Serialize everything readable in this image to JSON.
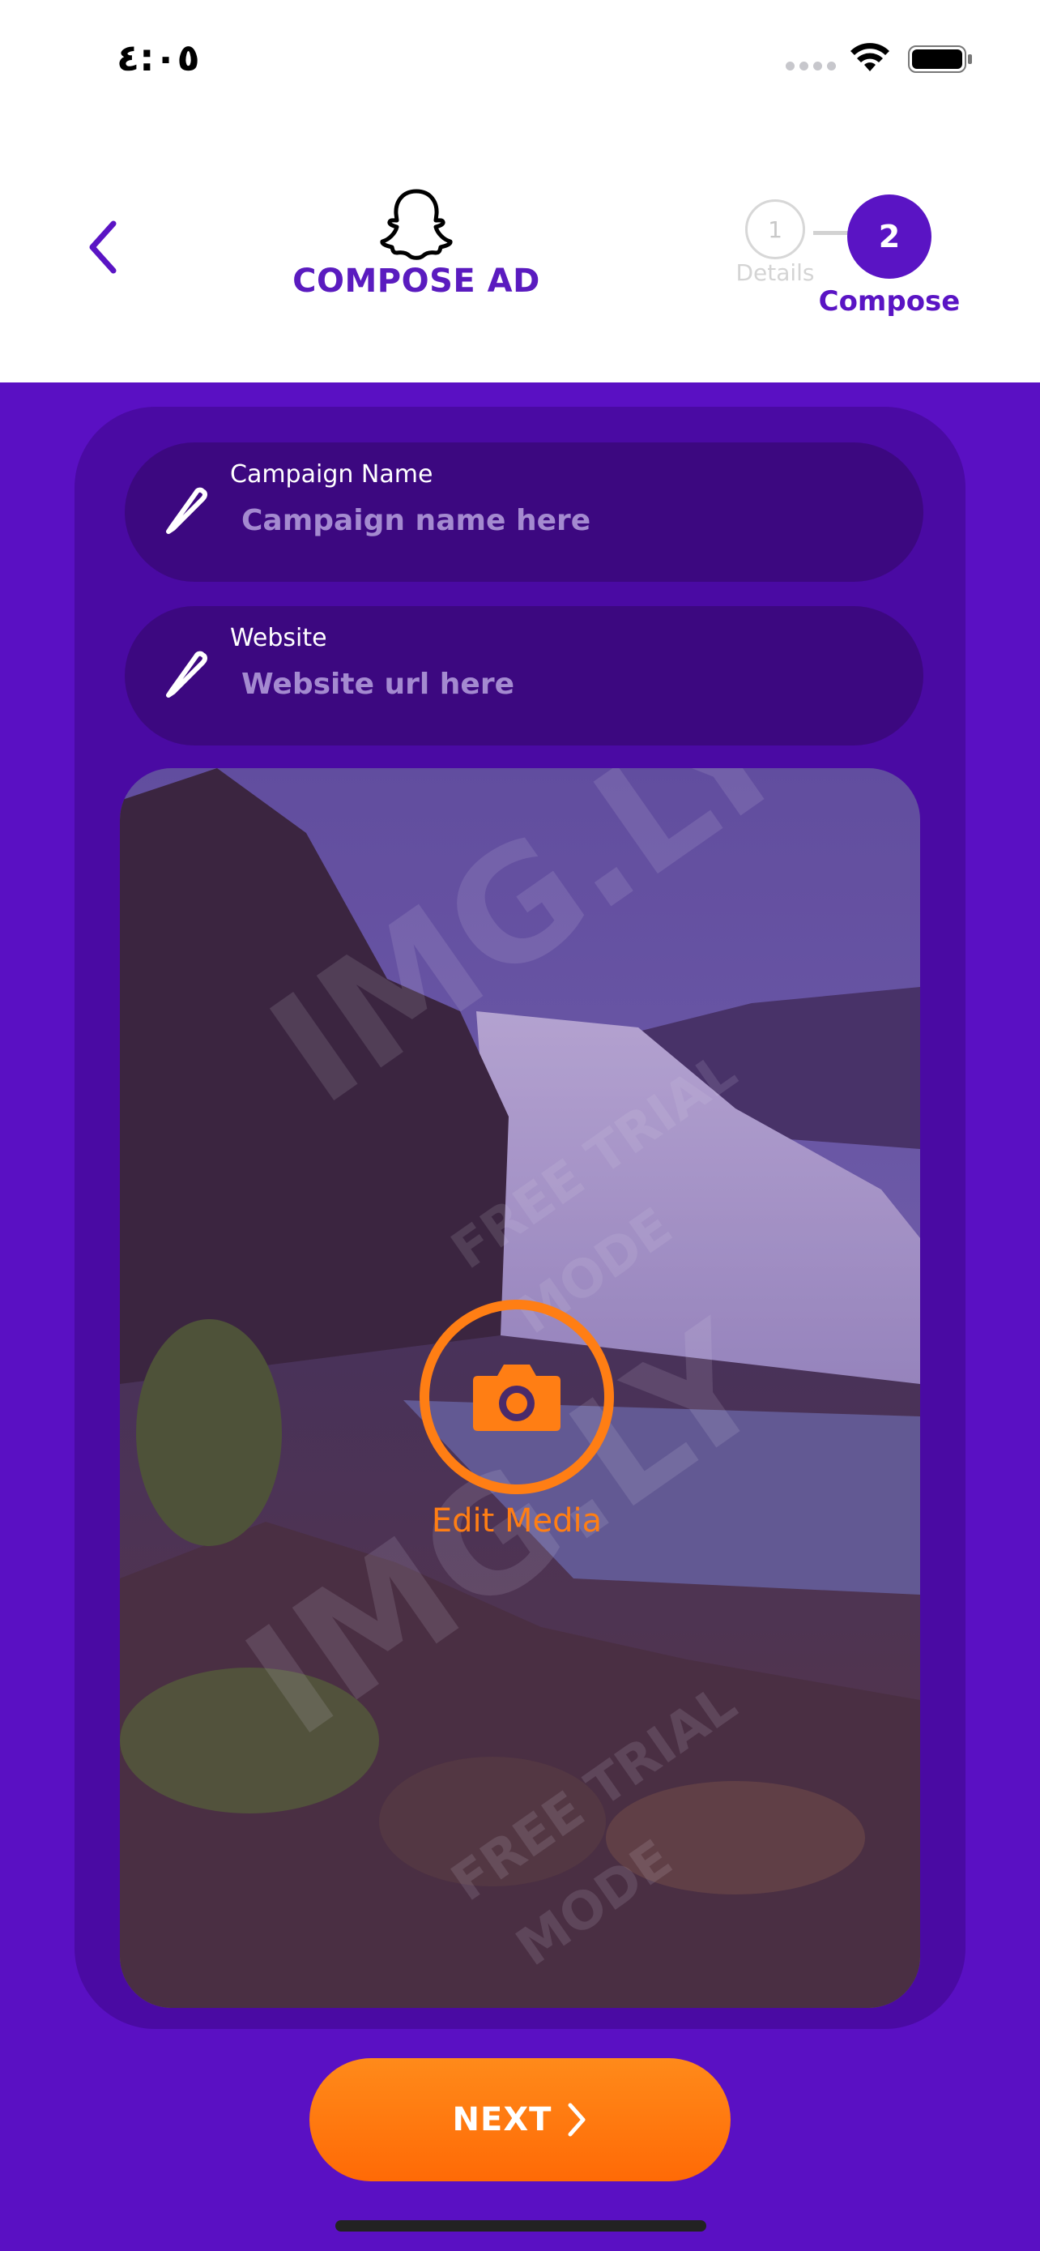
{
  "status_bar": {
    "time": "٤:٠٥"
  },
  "header": {
    "title": "COMPOSE AD",
    "steps": [
      {
        "number": "1",
        "label": "Details",
        "active": false
      },
      {
        "number": "2",
        "label": "Compose",
        "active": true
      }
    ]
  },
  "form": {
    "campaign_name": {
      "label": "Campaign Name",
      "placeholder": "Campaign name here",
      "value": ""
    },
    "website": {
      "label": "Website",
      "placeholder": "Website url here",
      "value": ""
    }
  },
  "media": {
    "edit_label": "Edit Media",
    "watermark_lines": [
      "IMG.LY",
      "FREE TRIAL",
      "MODE"
    ]
  },
  "footer": {
    "next_label": "NEXT"
  },
  "colors": {
    "brand_purple": "#5a14c4",
    "accent_orange": "#ff7e14",
    "card_purple": "#4a0aa3"
  },
  "icons": [
    "back-chevron-icon",
    "snapchat-ghost-icon",
    "pencil-icon",
    "camera-icon",
    "chevron-right-icon",
    "wifi-icon",
    "battery-icon"
  ]
}
